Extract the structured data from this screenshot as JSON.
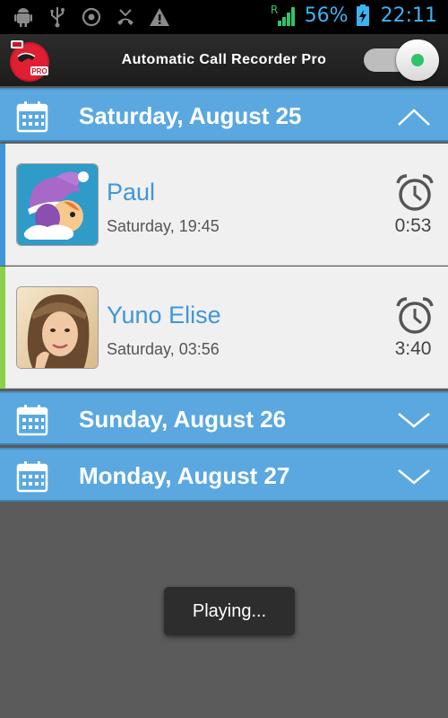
{
  "status_bar": {
    "icons": [
      "android-debug-icon",
      "usb-icon",
      "sync-icon",
      "missed-call-icon",
      "warning-icon"
    ],
    "signal_label": "R",
    "battery_percent": "56%",
    "time": "22:11"
  },
  "app": {
    "logo_label": "PRO",
    "title": "Automatic Call Recorder Pro",
    "recording_enabled": true,
    "accent_color": "#5aa8df"
  },
  "days": [
    {
      "title": "Saturday, August 25",
      "expanded": true,
      "calls": [
        {
          "name": "Paul",
          "time": "Saturday, 19:45",
          "duration": "0:53",
          "accent": "#3f96d8",
          "avatar": "cartoon-character-avatar"
        },
        {
          "name": "Yuno Elise",
          "time": "Saturday, 03:56",
          "duration": "3:40",
          "accent": "#8ad24a",
          "avatar": "photo-avatar"
        }
      ]
    },
    {
      "title": "Sunday, August 26",
      "expanded": false,
      "calls": []
    },
    {
      "title": "Monday, August 27",
      "expanded": false,
      "calls": []
    }
  ],
  "toast": {
    "message": "Playing..."
  }
}
